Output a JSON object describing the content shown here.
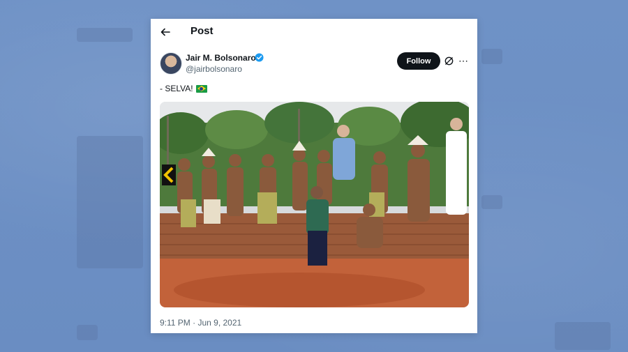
{
  "header": {
    "title": "Post"
  },
  "author": {
    "name": "Jair M. Bolsonaro",
    "handle": "@jairbolsonaro",
    "verified": true
  },
  "actions": {
    "follow_label": "Follow"
  },
  "tweet": {
    "text": "- SELVA!",
    "flag_emoji": "brazil-flag"
  },
  "media": {
    "description_icon": "photo"
  },
  "meta": {
    "timestamp": "9:11 PM · Jun 9, 2021"
  },
  "colors": {
    "background": "#6b8fc4",
    "card": "#ffffff",
    "verified": "#1d9bf0",
    "follow_bg": "#0f1419"
  }
}
